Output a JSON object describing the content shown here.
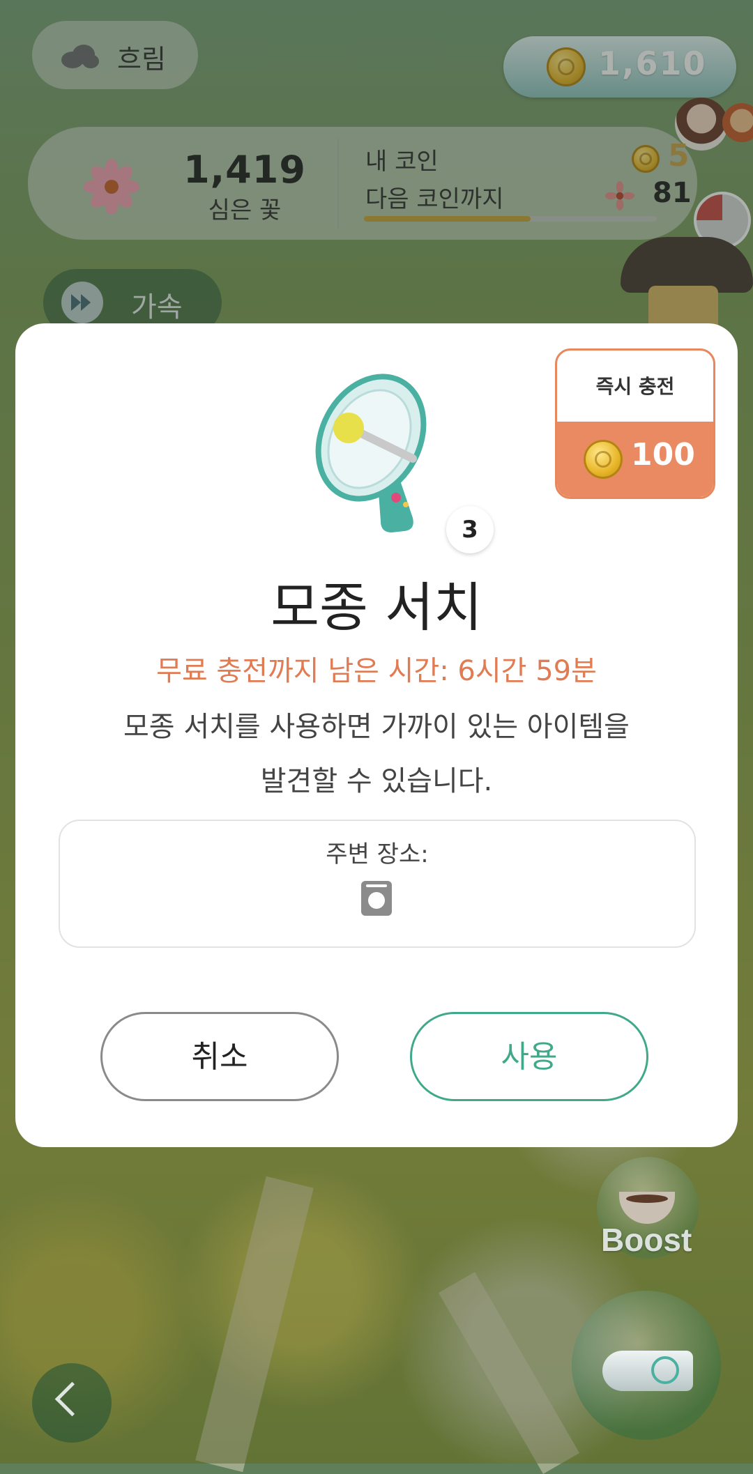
{
  "hud": {
    "weather_label": "흐림",
    "coin_total": "1,610",
    "planted_count": "1,419",
    "planted_label": "심은 꽃",
    "my_coin_label": "내 코인",
    "next_coin_label": "다음 코인까지",
    "my_coin_value": "5",
    "next_coin_value": "81",
    "next_coin_progress": 0.57,
    "speed_label": "가속"
  },
  "modal": {
    "instant_charge_label": "즉시 충전",
    "instant_charge_price": "100",
    "item_count": "3",
    "item_title": "모종 서치",
    "recharge_text": "무료 충전까지 남은 시간: 6시간 59분",
    "description_line1": "모종 서치를 사용하면 가까이 있는 아이템을",
    "description_line2": "발견할 수 있습니다.",
    "nearby_label": "주변 장소:",
    "nearby_place_icon": "washing-machine-icon",
    "cancel_label": "취소",
    "use_label": "사용"
  },
  "side": {
    "boost_label": "Boost"
  },
  "colors": {
    "accent_orange": "#ea8a62",
    "accent_green": "#3fa98a",
    "coin_gold": "#e8b62a"
  }
}
